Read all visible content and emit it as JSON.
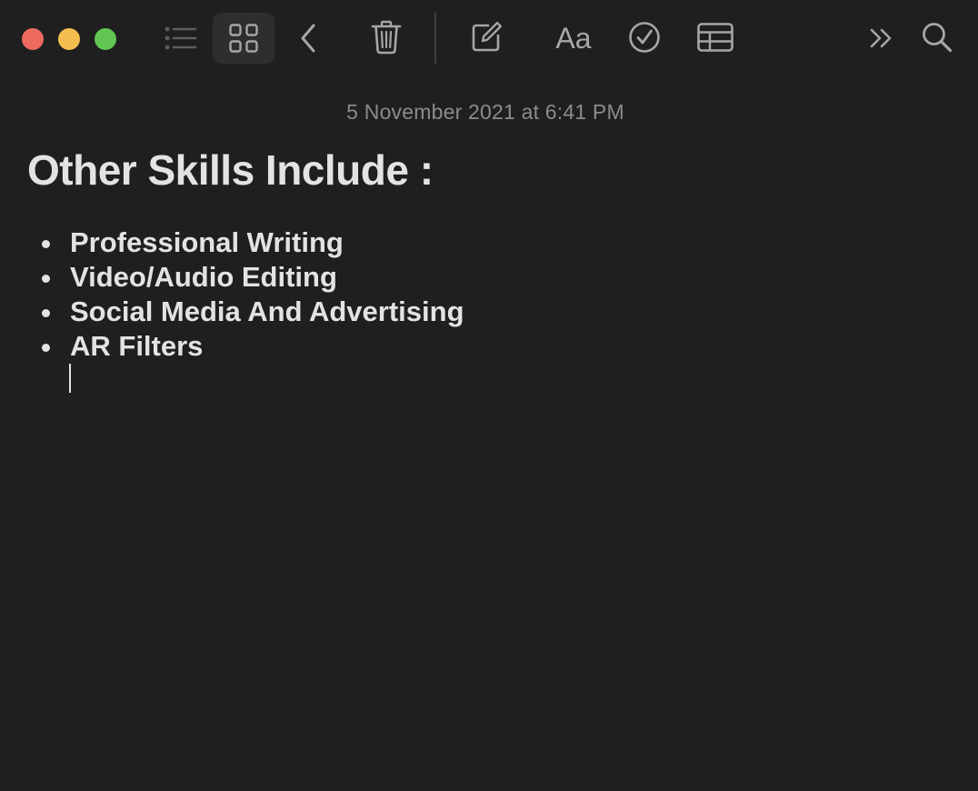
{
  "window": {
    "controls": {
      "close": "close-window",
      "minimize": "minimize-window",
      "zoom": "zoom-window"
    }
  },
  "toolbar": {
    "icons": {
      "list_view": "list-icon",
      "gallery_view": "grid-icon",
      "back": "chevron-left-icon",
      "delete": "trash-icon",
      "compose": "compose-icon",
      "checklist": "checkmark-circle-icon",
      "table": "table-icon",
      "more": "double-chevron-right-icon",
      "search": "search-icon"
    },
    "format_label": "Aa",
    "active_view": "gallery"
  },
  "note": {
    "timestamp": "5 November 2021 at 6:41 PM",
    "title": "Other Skills Include :",
    "items": [
      "Professional Writing",
      "Video/Audio Editing",
      "Social Media And Advertising",
      "AR Filters"
    ]
  },
  "colors": {
    "background": "#1f1f1f",
    "text": "#e3e3e3",
    "muted_text": "#8b8b8b",
    "close": "#ed6a5e",
    "minimize": "#f4bf4f",
    "zoom": "#61c554"
  }
}
